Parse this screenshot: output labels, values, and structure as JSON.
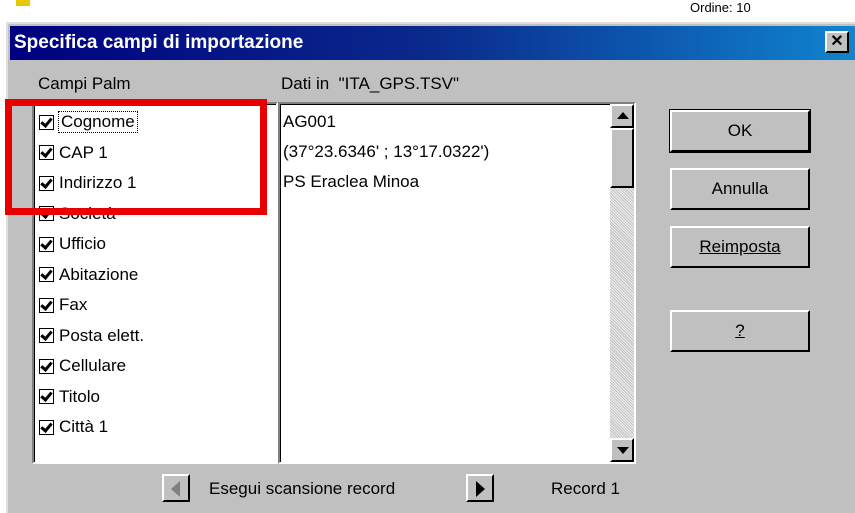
{
  "background_peek": {
    "text": "Ordine: 10"
  },
  "dialog": {
    "title": "Specifica campi di importazione",
    "close_glyph": "✕"
  },
  "left_panel": {
    "label": "Campi Palm",
    "fields": [
      {
        "label": "Cognome",
        "checked": true
      },
      {
        "label": "CAP 1",
        "checked": true
      },
      {
        "label": "Indirizzo 1",
        "checked": true
      },
      {
        "label": "Società",
        "checked": true
      },
      {
        "label": "Ufficio",
        "checked": true
      },
      {
        "label": "Abitazione",
        "checked": true
      },
      {
        "label": "Fax",
        "checked": true
      },
      {
        "label": "Posta elett.",
        "checked": true
      },
      {
        "label": "Cellulare",
        "checked": true
      },
      {
        "label": "Titolo",
        "checked": true
      },
      {
        "label": "Città 1",
        "checked": true
      }
    ]
  },
  "data_panel": {
    "label_prefix": "Dati in",
    "filename": "\"ITA_GPS.TSV\"",
    "rows": [
      "AG001",
      "(37°23.6346' ; 13°17.0322')",
      "PS Eraclea Minoa"
    ]
  },
  "buttons": {
    "ok": "OK",
    "annulla": "Annulla",
    "reimposta": "Reimposta",
    "help": "?"
  },
  "footer": {
    "scan_label": "Esegui scansione record",
    "record_label": "Record 1"
  },
  "colors": {
    "title_start": "#000080",
    "title_end": "#1084d0",
    "face": "#c0c0c0",
    "highlight": "#e80000"
  }
}
